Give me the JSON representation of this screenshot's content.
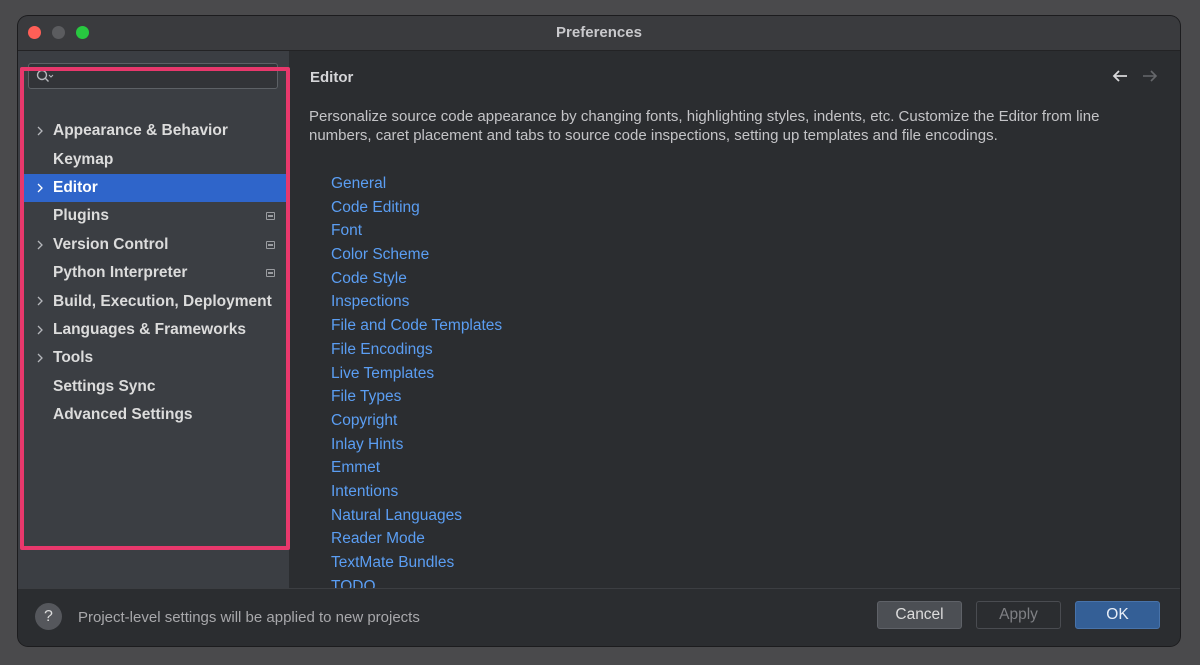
{
  "window": {
    "title": "Preferences"
  },
  "sidebar": {
    "search": {
      "placeholder": ""
    },
    "items": [
      {
        "label": "Appearance & Behavior",
        "expandable": true,
        "badge": false,
        "selected": false
      },
      {
        "label": "Keymap",
        "expandable": false,
        "badge": false,
        "selected": false
      },
      {
        "label": "Editor",
        "expandable": true,
        "badge": false,
        "selected": true
      },
      {
        "label": "Plugins",
        "expandable": false,
        "badge": true,
        "selected": false
      },
      {
        "label": "Version Control",
        "expandable": true,
        "badge": true,
        "selected": false
      },
      {
        "label": "Python Interpreter",
        "expandable": false,
        "badge": true,
        "selected": false
      },
      {
        "label": "Build, Execution, Deployment",
        "expandable": true,
        "badge": false,
        "selected": false
      },
      {
        "label": "Languages & Frameworks",
        "expandable": true,
        "badge": false,
        "selected": false
      },
      {
        "label": "Tools",
        "expandable": true,
        "badge": false,
        "selected": false
      },
      {
        "label": "Settings Sync",
        "expandable": false,
        "badge": false,
        "selected": false
      },
      {
        "label": "Advanced Settings",
        "expandable": false,
        "badge": false,
        "selected": false
      }
    ]
  },
  "content": {
    "title": "Editor",
    "description": "Personalize source code appearance by changing fonts, highlighting styles, indents, etc. Customize the Editor from line numbers, caret placement and tabs to source code inspections, setting up templates and file encodings.",
    "links": [
      "General",
      "Code Editing",
      "Font",
      "Color Scheme",
      "Code Style",
      "Inspections",
      "File and Code Templates",
      "File Encodings",
      "Live Templates",
      "File Types",
      "Copyright",
      "Inlay Hints",
      "Emmet",
      "Intentions",
      "Natural Languages",
      "Reader Mode",
      "TextMate Bundles",
      "TODO"
    ]
  },
  "footer": {
    "help_label": "?",
    "text": "Project-level settings will be applied to new projects",
    "cancel_label": "Cancel",
    "apply_label": "Apply",
    "ok_label": "OK"
  },
  "icons": {
    "search": "search-icon",
    "back": "back-arrow-icon",
    "forward": "forward-arrow-icon",
    "chevron": "chevron-right-icon",
    "badge": "project-level-settings-icon"
  },
  "colors": {
    "selection": "#2f65ca",
    "link": "#5b9ef3",
    "highlight_border": "#e8386c",
    "ok_button": "#345f96"
  }
}
